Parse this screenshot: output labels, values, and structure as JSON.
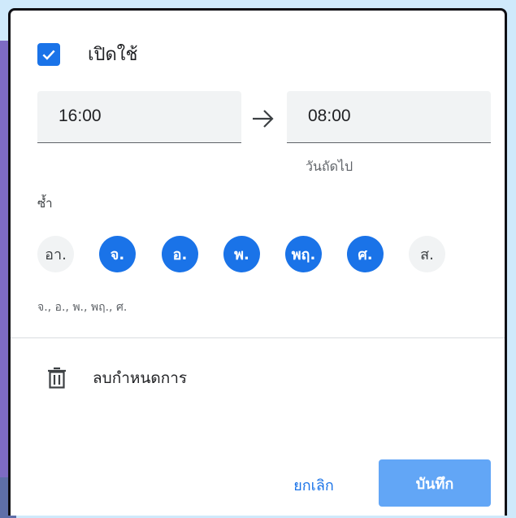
{
  "enable": {
    "label": "เปิดใช้",
    "checked": true
  },
  "time_range": {
    "start": "16:00",
    "end": "08:00",
    "next_day_label": "วันถัดไป"
  },
  "repeat": {
    "label": "ซ้ำ",
    "days": [
      {
        "label": "อา.",
        "selected": false
      },
      {
        "label": "จ.",
        "selected": true
      },
      {
        "label": "อ.",
        "selected": true
      },
      {
        "label": "พ.",
        "selected": true
      },
      {
        "label": "พฤ.",
        "selected": true
      },
      {
        "label": "ศ.",
        "selected": true
      },
      {
        "label": "ส.",
        "selected": false
      }
    ],
    "summary": "จ., อ., พ., พฤ., ศ."
  },
  "delete": {
    "label": "ลบกำหนดการ"
  },
  "actions": {
    "cancel_label": "ยกเลิก",
    "save_label": "บันทึก"
  },
  "colors": {
    "accent": "#1a73e8",
    "save_button": "#62a6f6",
    "field_bg": "#f1f3f4"
  }
}
